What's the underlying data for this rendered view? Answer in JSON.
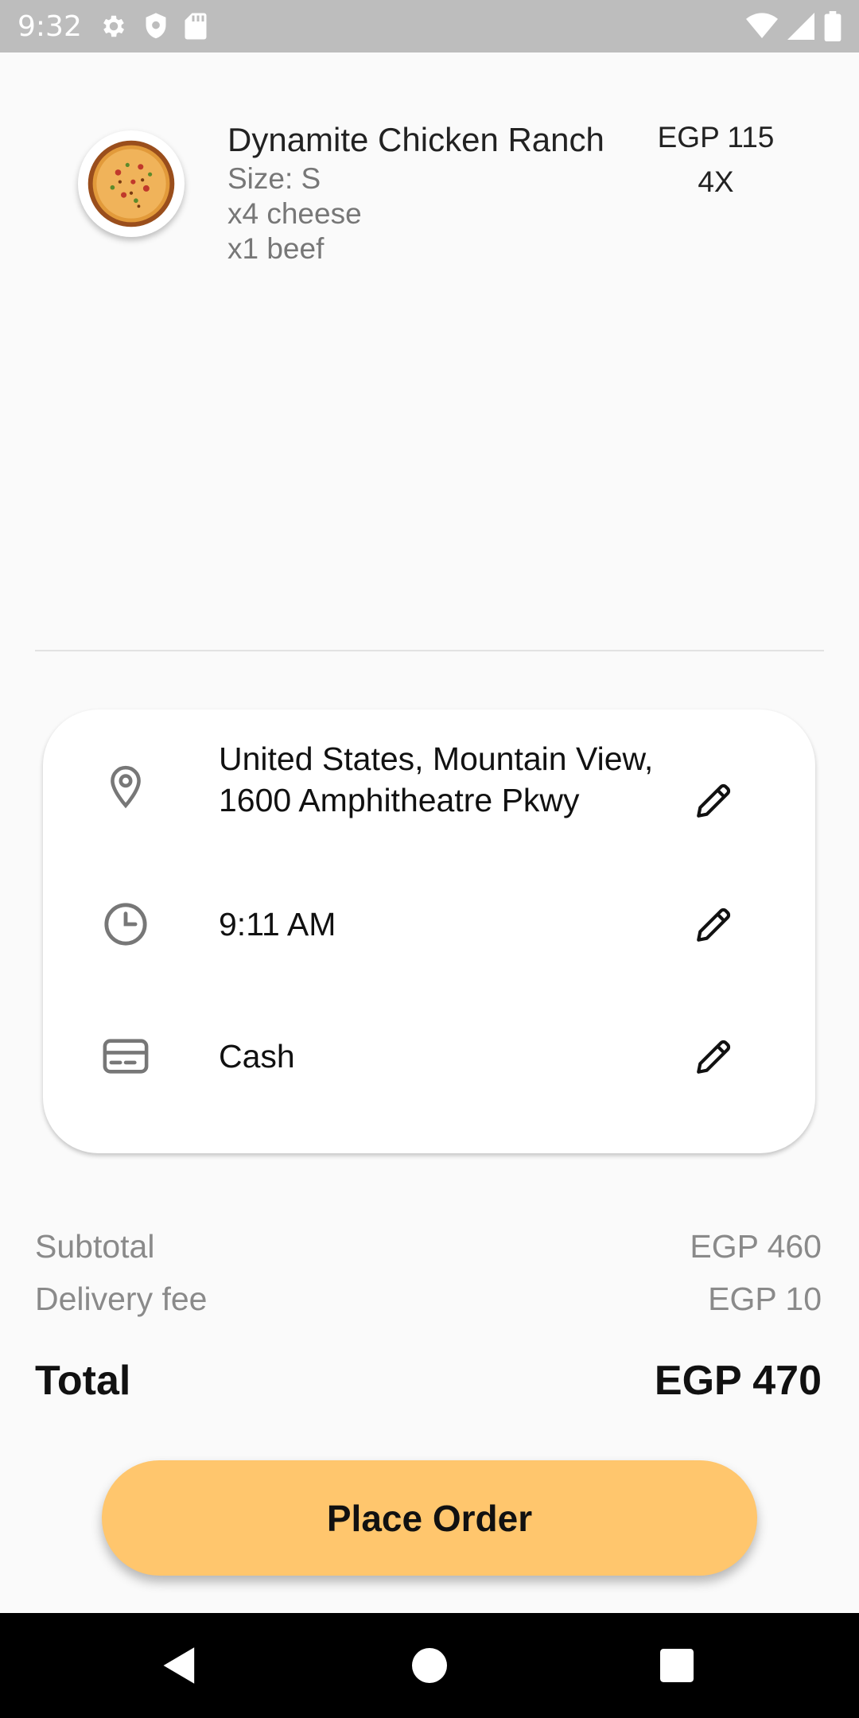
{
  "status_bar": {
    "time": "9:32",
    "icons": [
      "gear-icon",
      "shield-icon",
      "sd-card-icon",
      "wifi-icon",
      "signal-icon",
      "battery-icon"
    ]
  },
  "cart_item": {
    "name": "Dynamite Chicken Ranch",
    "size": "Size: S",
    "extras": [
      "x4 cheese",
      "x1 beef"
    ],
    "price": "EGP 115",
    "quantity": "4X",
    "image_icon": "pizza-icon"
  },
  "details": {
    "address": "United States, Mountain View, 1600 Amphitheatre Pkwy",
    "time": "9:11 AM",
    "payment": "Cash",
    "icons": {
      "address": "location-pin-icon",
      "time": "clock-icon",
      "payment": "credit-card-icon",
      "edit": "pencil-icon"
    }
  },
  "summary": {
    "subtotal_label": "Subtotal",
    "subtotal_value": "EGP 460",
    "delivery_label": "Delivery fee",
    "delivery_value": "EGP 10",
    "total_label": "Total",
    "total_value": "EGP 470"
  },
  "actions": {
    "place_order_label": "Place Order"
  },
  "colors": {
    "accent": "#ffc66d",
    "background": "#fafafa",
    "status_bar": "#bdbdbd"
  }
}
